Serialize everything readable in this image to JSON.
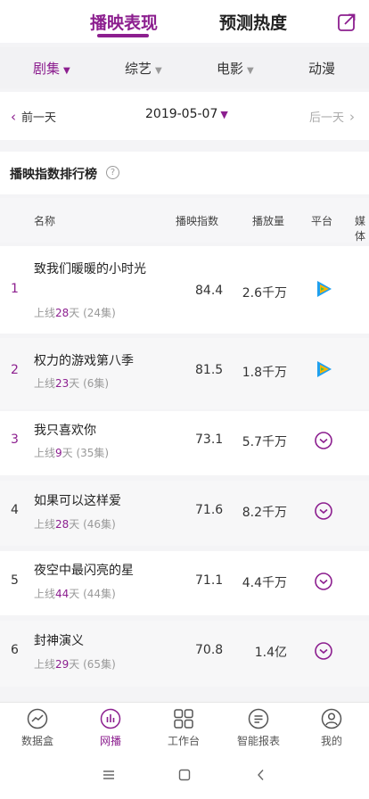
{
  "header": {
    "tab_active": "播映表现",
    "tab_inactive": "预测热度",
    "share_icon": "share-icon"
  },
  "categories": [
    "剧集",
    "综艺",
    "电影",
    "动漫"
  ],
  "date_bar": {
    "prev": "前一天",
    "date": "2019-05-07",
    "next": "后一天"
  },
  "section": {
    "title": "播映指数排行榜",
    "help": "?"
  },
  "table": {
    "headers": [
      "名称",
      "播映指数",
      "播放量",
      "平台",
      "媒体"
    ],
    "rows": [
      {
        "rank": "1",
        "title": "致我们暖暖的小时光",
        "sub_pre": "上线",
        "days": "28",
        "sub_post": "天 (24集)",
        "score": "84.4",
        "views": "2.6千万",
        "platform": "tencent-video-icon"
      },
      {
        "rank": "2",
        "title": "权力的游戏第八季",
        "sub_pre": "上线",
        "days": "23",
        "sub_post": "天 (6集)",
        "score": "81.5",
        "views": "1.8千万",
        "platform": "tencent-video-icon"
      },
      {
        "rank": "3",
        "title": "我只喜欢你",
        "sub_pre": "上线",
        "days": "9",
        "sub_post": "天 (35集)",
        "score": "73.1",
        "views": "5.7千万",
        "platform": "youku-icon"
      },
      {
        "rank": "4",
        "title": "如果可以这样爱",
        "sub_pre": "上线",
        "days": "28",
        "sub_post": "天 (46集)",
        "score": "71.6",
        "views": "8.2千万",
        "platform": "youku-icon"
      },
      {
        "rank": "5",
        "title": "夜空中最闪亮的星",
        "sub_pre": "上线",
        "days": "44",
        "sub_post": "天 (44集)",
        "score": "71.1",
        "views": "4.4千万",
        "platform": "youku-icon"
      },
      {
        "rank": "6",
        "title": "封神演义",
        "sub_pre": "上线",
        "days": "29",
        "sub_post": "天 (65集)",
        "score": "70.8",
        "views": "1.4亿",
        "platform": "youku-icon"
      }
    ]
  },
  "bottom_nav": [
    "数据盒",
    "网播",
    "工作台",
    "智能报表",
    "我的"
  ],
  "colors": {
    "accent": "#8c1f8f",
    "muted": "#999999"
  }
}
